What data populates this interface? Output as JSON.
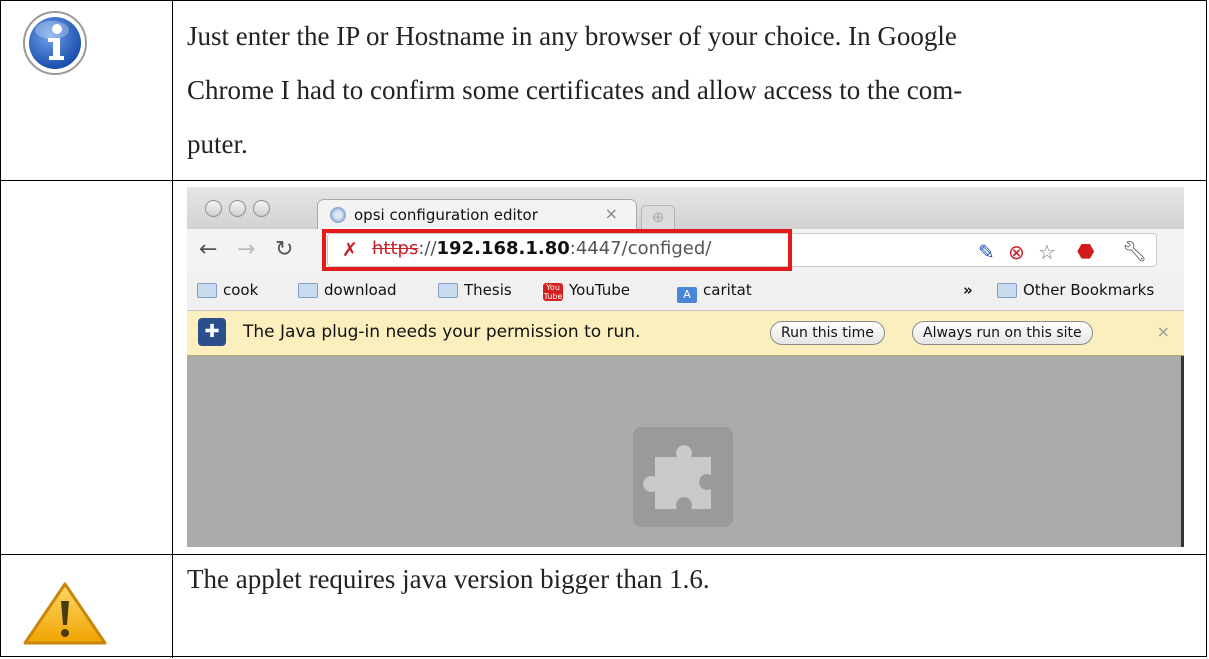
{
  "rows": [
    {
      "icon": "info-icon",
      "text": "Just enter the IP or Hostname in any browser of your choice. In Google Chrome I had to confirm some certificates and allow access to the com-puter."
    },
    {
      "icon": "",
      "text": ""
    },
    {
      "icon": "warning-icon",
      "text": "The applet requires java version bigger than 1.6."
    }
  ],
  "text_lines": {
    "row1_line1": "Just enter the IP or Hostname in any browser of your choice. In Google",
    "row1_line2": "Chrome I had to confirm some certificates and allow access to the com-",
    "row1_line3": "puter.",
    "row3_line1": "The applet requires java version bigger than 1.6."
  },
  "browser": {
    "tab_title": "opsi configuration editor",
    "tab_close": "×",
    "url_protocol": "https",
    "url_separator": "://",
    "url_host": "192.168.1.80",
    "url_rest": ":4447/configed/",
    "bookmarks": [
      {
        "label": "cook",
        "icon": "folder-icon"
      },
      {
        "label": "download",
        "icon": "folder-icon"
      },
      {
        "label": "Thesis",
        "icon": "folder-icon"
      },
      {
        "label": "YouTube",
        "icon": "youtube-icon"
      },
      {
        "label": "caritat",
        "icon": "translate-icon"
      }
    ],
    "bookmarks_overflow": "»",
    "other_bookmarks": "Other Bookmarks",
    "infobar_text": "The Java plug-in needs your permission to run.",
    "run_once": "Run this time",
    "always_run": "Always run on this site",
    "infobar_close": "×"
  },
  "colors": {
    "highlight": "#e31b1b",
    "infobar": "#fbf0bd",
    "content_bg": "#ababab"
  }
}
